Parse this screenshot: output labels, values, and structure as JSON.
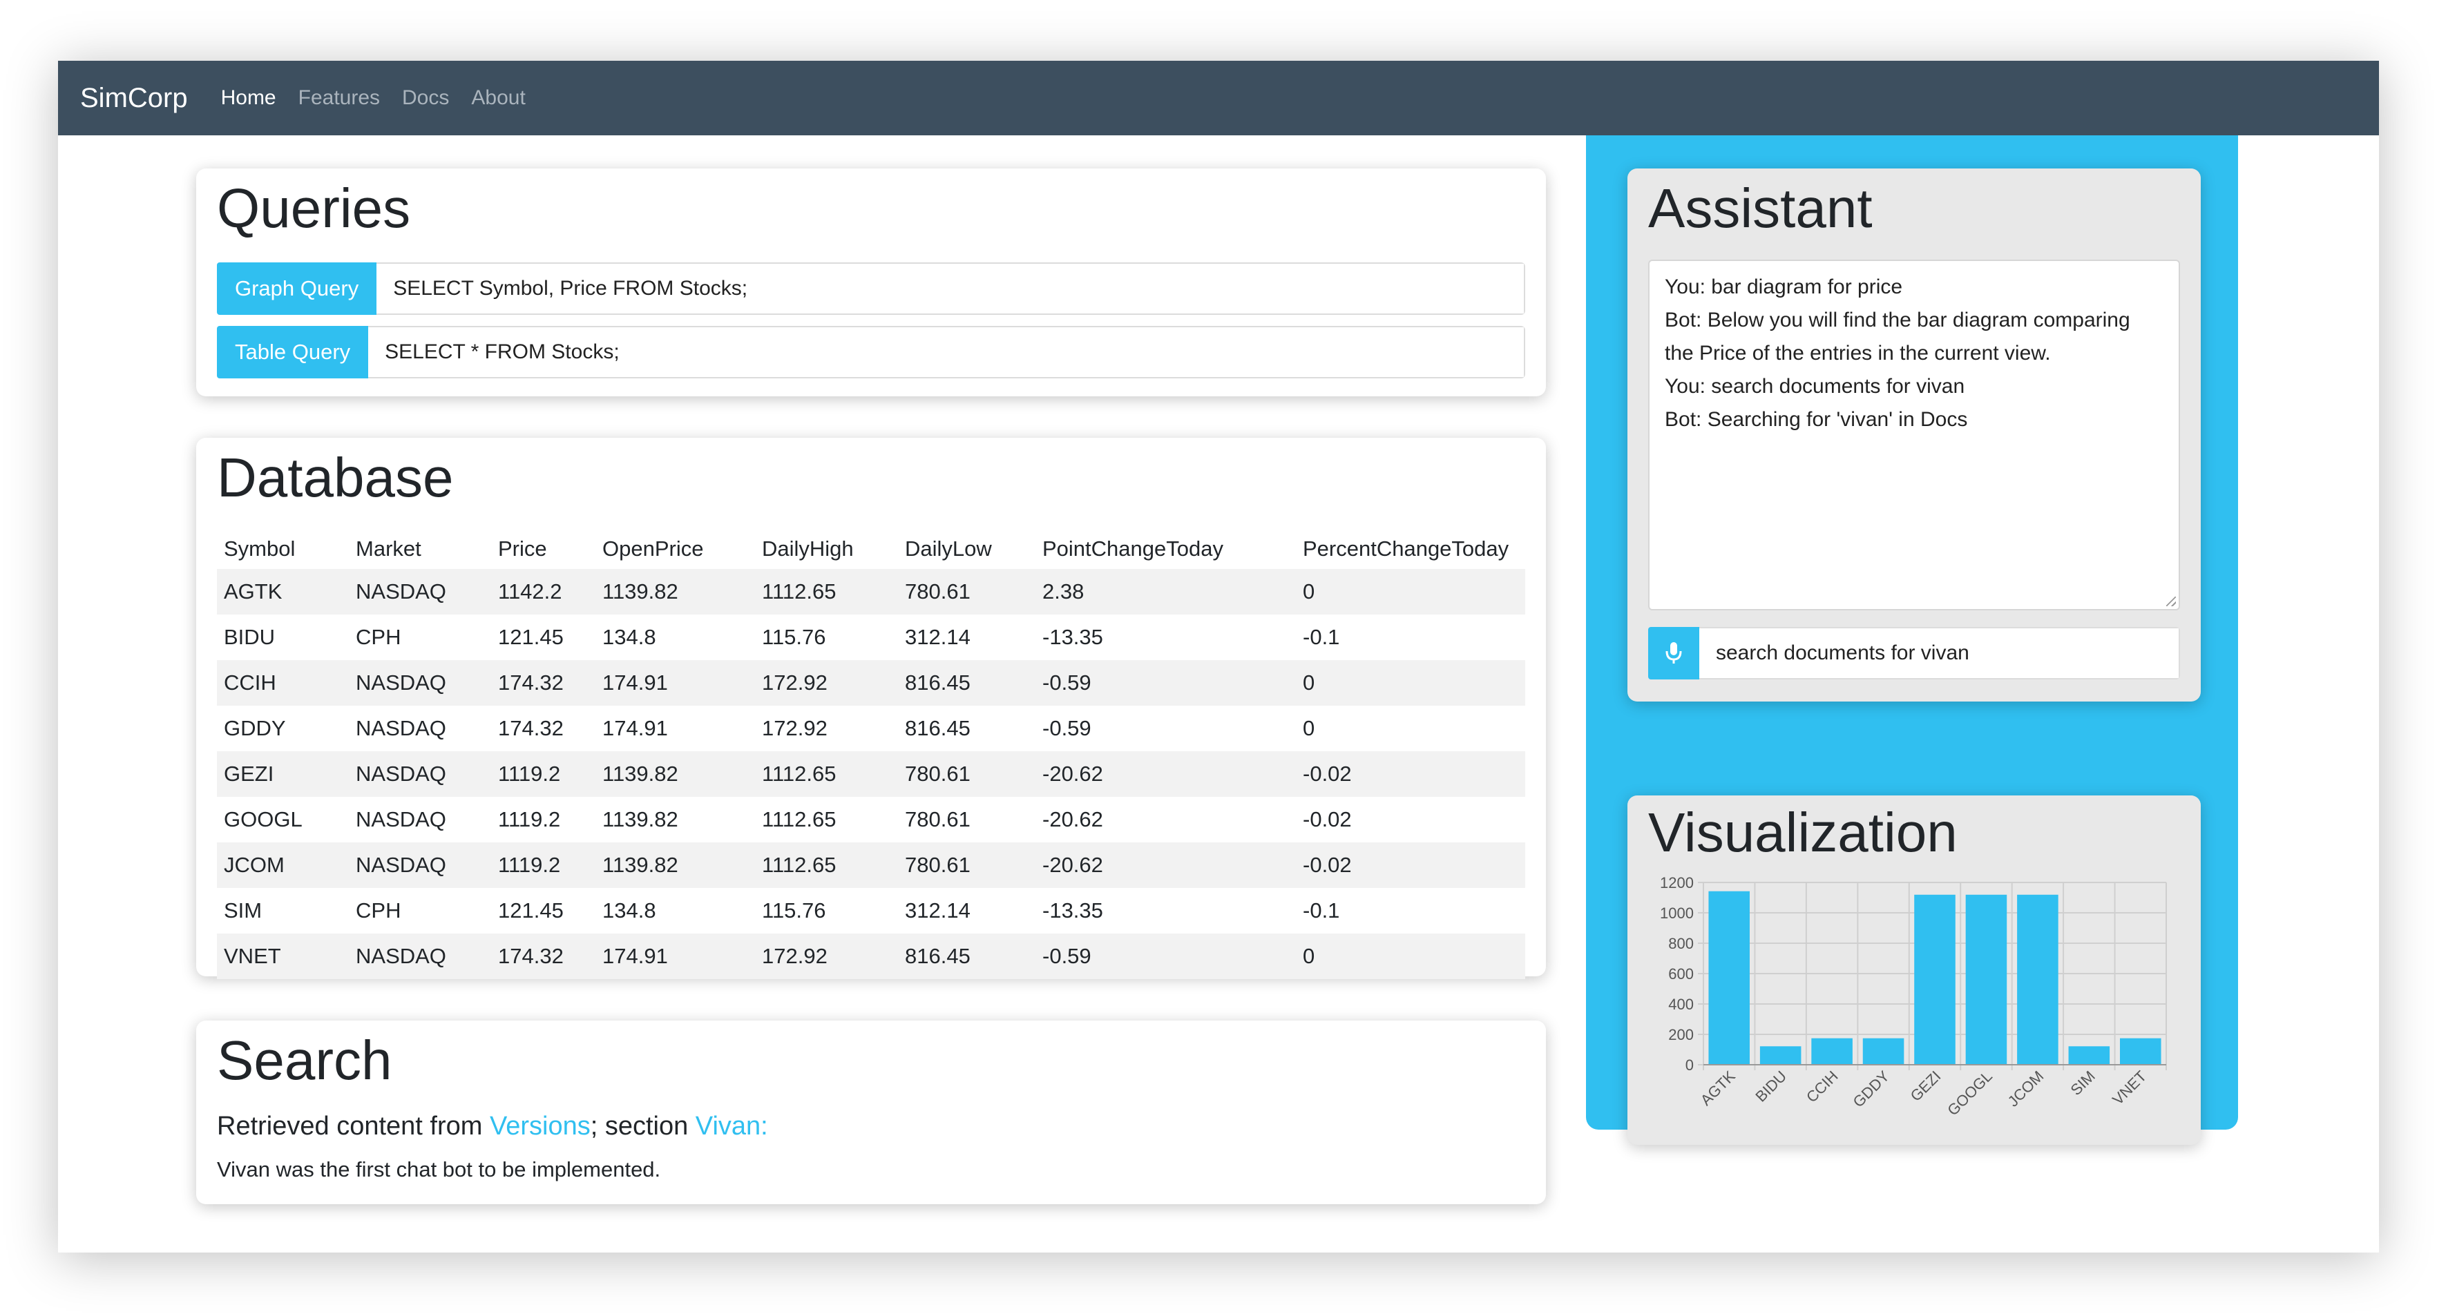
{
  "nav": {
    "brand": "SimCorp",
    "links": [
      "Home",
      "Features",
      "Docs",
      "About"
    ]
  },
  "queries": {
    "title": "Queries",
    "graph_label": "Graph Query",
    "graph_value": "SELECT Symbol, Price FROM Stocks;",
    "table_label": "Table Query",
    "table_value": "SELECT * FROM Stocks;"
  },
  "database": {
    "title": "Database",
    "columns": [
      "Symbol",
      "Market",
      "Price",
      "OpenPrice",
      "DailyHigh",
      "DailyLow",
      "PointChangeToday",
      "PercentChangeToday"
    ],
    "rows": [
      [
        "AGTK",
        "NASDAQ",
        "1142.2",
        "1139.82",
        "1112.65",
        "780.61",
        "2.38",
        "0"
      ],
      [
        "BIDU",
        "CPH",
        "121.45",
        "134.8",
        "115.76",
        "312.14",
        "-13.35",
        "-0.1"
      ],
      [
        "CCIH",
        "NASDAQ",
        "174.32",
        "174.91",
        "172.92",
        "816.45",
        "-0.59",
        "0"
      ],
      [
        "GDDY",
        "NASDAQ",
        "174.32",
        "174.91",
        "172.92",
        "816.45",
        "-0.59",
        "0"
      ],
      [
        "GEZI",
        "NASDAQ",
        "1119.2",
        "1139.82",
        "1112.65",
        "780.61",
        "-20.62",
        "-0.02"
      ],
      [
        "GOOGL",
        "NASDAQ",
        "1119.2",
        "1139.82",
        "1112.65",
        "780.61",
        "-20.62",
        "-0.02"
      ],
      [
        "JCOM",
        "NASDAQ",
        "1119.2",
        "1139.82",
        "1112.65",
        "780.61",
        "-20.62",
        "-0.02"
      ],
      [
        "SIM",
        "CPH",
        "121.45",
        "134.8",
        "115.76",
        "312.14",
        "-13.35",
        "-0.1"
      ],
      [
        "VNET",
        "NASDAQ",
        "174.32",
        "174.91",
        "172.92",
        "816.45",
        "-0.59",
        "0"
      ]
    ]
  },
  "search": {
    "title": "Search",
    "prefix": "Retrieved content from ",
    "link1": "Versions",
    "middle": "; section ",
    "link2": "Vivan:",
    "snippet": "Vivan was the first chat bot to be implemented."
  },
  "assistant": {
    "title": "Assistant",
    "messages": [
      "You: bar diagram for price",
      "Bot: Below you will find the bar diagram comparing the Price of the entries in the current view.",
      "You: search documents for vivan",
      "Bot: Searching for 'vivan' in Docs"
    ],
    "input_value": "search documents for vivan"
  },
  "visualization": {
    "title": "Visualization"
  },
  "chart_data": {
    "type": "bar",
    "categories": [
      "AGTK",
      "BIDU",
      "CCIH",
      "GDDY",
      "GEZI",
      "GOOGL",
      "JCOM",
      "SIM",
      "VNET"
    ],
    "values": [
      1142.2,
      121.45,
      174.32,
      174.32,
      1119.2,
      1119.2,
      1119.2,
      121.45,
      174.32
    ],
    "yticks": [
      0,
      200,
      400,
      600,
      800,
      1000,
      1200
    ],
    "ylim": [
      0,
      1200
    ],
    "grid": true,
    "bar_color": "#30bff0"
  },
  "colors": {
    "accent": "#30bff0",
    "navbar": "#3d4f5f"
  },
  "icons": {
    "mic": "microphone-icon"
  }
}
